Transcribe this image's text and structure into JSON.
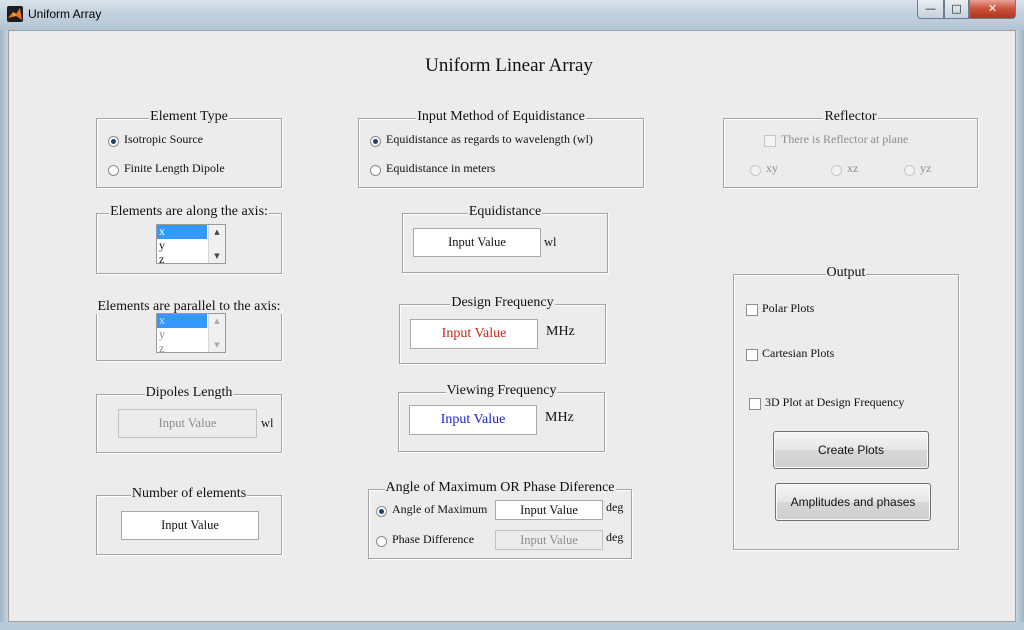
{
  "window": {
    "title": "Uniform Array",
    "min": "—",
    "max": "□",
    "close": "✕"
  },
  "main_title": "Uniform Linear Array",
  "element_type": {
    "title": "Element Type",
    "options": [
      "Isotropic Source",
      "Finite Length Dipole"
    ],
    "selected": "Isotropic Source"
  },
  "along_axis": {
    "title": "Elements are along the axis:",
    "items": [
      "x",
      "y",
      "z"
    ],
    "selected": "x"
  },
  "parallel_axis": {
    "title": "Elements are parallel to the axis:",
    "items": [
      "x",
      "y",
      "z"
    ],
    "selected": "x"
  },
  "dipoles_length": {
    "title": "Dipoles Length",
    "value": "Input Value",
    "unit": "wl"
  },
  "num_elements": {
    "title": "Number of elements",
    "value": "Input Value"
  },
  "input_method": {
    "title": "Input Method of Equidistance",
    "options": [
      "Equidistance as regards to wavelength (wl)",
      "Equidistance in meters"
    ],
    "selected": "Equidistance as regards to wavelength (wl)"
  },
  "equidistance": {
    "title": "Equidistance",
    "value": "Input Value",
    "unit": "wl"
  },
  "design_freq": {
    "title": "Design Frequency",
    "value": "Input Value",
    "unit": "MHz",
    "color": "#c0281c"
  },
  "viewing_freq": {
    "title": "Viewing Frequency",
    "value": "Input Value",
    "unit": "MHz",
    "color": "#1a24c8"
  },
  "angle_phase": {
    "title": "Angle of Maximum OR Phase Diference",
    "angle_label": "Angle of Maximum",
    "angle_value": "Input Value",
    "angle_unit": "deg",
    "phase_label": "Phase Difference",
    "phase_value": "Input Value",
    "phase_unit": "deg"
  },
  "reflector": {
    "title": "Reflector",
    "check_label": "There is Reflector at plane",
    "planes": [
      "xy",
      "xz",
      "yz"
    ]
  },
  "output": {
    "title": "Output",
    "checks": [
      "Polar Plots",
      "Cartesian Plots",
      "3D Plot at Design Frequency"
    ],
    "create_button": "Create Plots",
    "amp_button": "Amplitudes and phases"
  }
}
